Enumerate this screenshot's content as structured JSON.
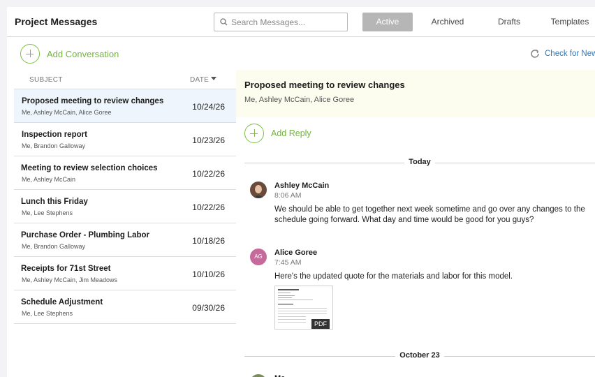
{
  "header": {
    "title": "Project Messages",
    "search_placeholder": "Search Messages...",
    "tabs": [
      {
        "label": "Active",
        "active": true
      },
      {
        "label": "Archived",
        "active": false
      },
      {
        "label": "Drafts",
        "active": false
      },
      {
        "label": "Templates",
        "active": false
      }
    ]
  },
  "toolbar": {
    "add_conversation": "Add Conversation",
    "check_new": "Check for New"
  },
  "list": {
    "col_subject": "SUBJECT",
    "col_date": "DATE",
    "rows": [
      {
        "subject": "Proposed meeting to review changes",
        "participants": "Me, Ashley McCain, Alice Goree",
        "date": "10/24/26",
        "selected": true
      },
      {
        "subject": "Inspection report",
        "participants": "Me, Brandon Galloway",
        "date": "10/23/26",
        "selected": false
      },
      {
        "subject": "Meeting to review selection choices",
        "participants": "Me, Ashley McCain",
        "date": "10/22/26",
        "selected": false
      },
      {
        "subject": "Lunch this Friday",
        "participants": "Me, Lee Stephens",
        "date": "10/22/26",
        "selected": false
      },
      {
        "subject": "Purchase Order - Plumbing Labor",
        "participants": "Me, Brandon Galloway",
        "date": "10/18/26",
        "selected": false
      },
      {
        "subject": "Receipts for 71st Street",
        "participants": "Me, Ashley McCain, Jim Meadows",
        "date": "10/10/26",
        "selected": false
      },
      {
        "subject": "Schedule Adjustment",
        "participants": "Me, Lee Stephens",
        "date": "09/30/26",
        "selected": false
      }
    ]
  },
  "detail": {
    "title": "Proposed meeting to review changes",
    "participants": "Me, Ashley McCain, Alice Goree",
    "add_reply": "Add Reply",
    "dividers": [
      "Today",
      "October 23"
    ],
    "messages": [
      {
        "name": "Ashley McCain",
        "time": "8:06 AM",
        "body": "We should be able to get together next week sometime and go over any changes to the schedule going forward. What day and time would be good for you guys?"
      },
      {
        "name": "Alice Goree",
        "initials": "AG",
        "time": "7:45 AM",
        "body": "Here's the updated quote for the materials and labor for this model.",
        "attachment": "PDF"
      },
      {
        "name": "Me"
      }
    ]
  },
  "colors": {
    "accent_green": "#7cc043",
    "link_blue": "#3177b8",
    "selected_row": "#eef5fc",
    "detail_header_bg": "#fdfdef",
    "active_tab": "#b6b6b6"
  }
}
